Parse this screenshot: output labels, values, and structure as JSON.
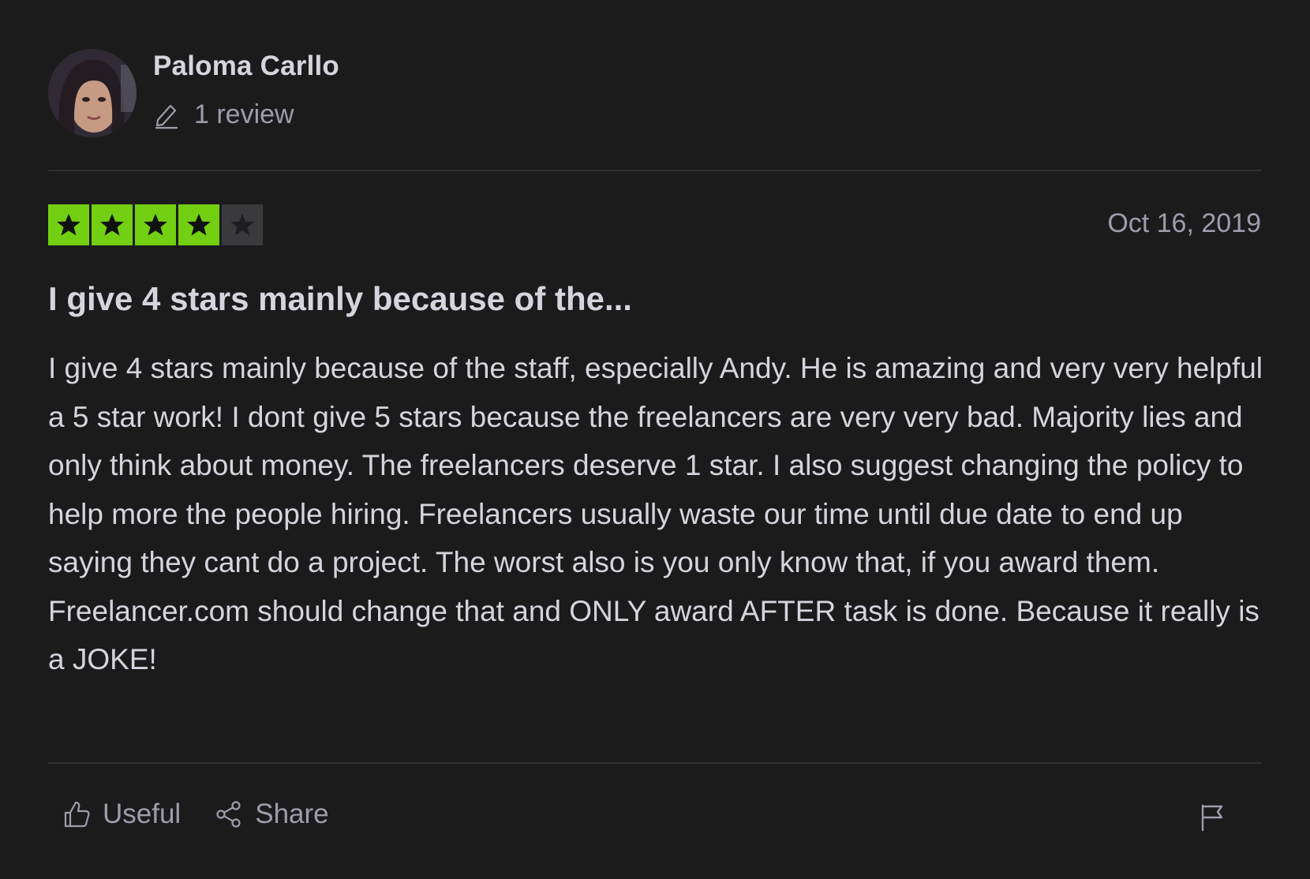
{
  "reviewer": {
    "name": "Paloma Carllo",
    "review_count": "1 review"
  },
  "review": {
    "rating": 4,
    "max_rating": 5,
    "date": "Oct 16, 2019",
    "title": "I give 4 stars mainly because of the...",
    "body": "I give 4 stars mainly because of the staff, especially Andy. He is amazing and very very helpful a 5 star work! I dont give 5 stars because the freelancers are very very bad. Majority lies and only think about money. The freelancers deserve 1 star. I also suggest changing the policy to help more the people hiring. Freelancers usually waste our time until due date to end up saying they cant do a project. The worst also is you only know that, if you award them. Freelancer.com should change that and ONLY award AFTER task is done. Because it really is a JOKE!"
  },
  "actions": {
    "useful_label": "Useful",
    "share_label": "Share"
  },
  "icons": {
    "review_count": "pencil-icon",
    "useful": "thumbs-up-icon",
    "share": "share-icon",
    "report": "flag-icon"
  },
  "colors": {
    "background": "#1b1b1c",
    "star_filled": "#73cf11",
    "star_empty": "#3a3a3d",
    "text_primary": "#d6d4dc",
    "text_secondary": "#9f9cab"
  }
}
